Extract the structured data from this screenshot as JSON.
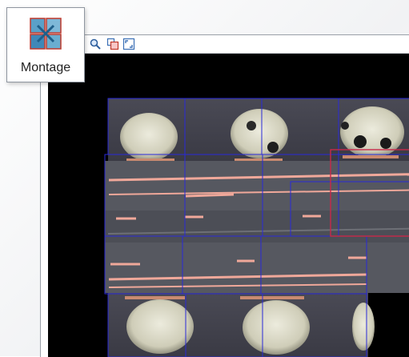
{
  "ribbon": {
    "montage_label": "Montage",
    "montage_icon": "montage-icon"
  },
  "toolbar": {
    "buttons": [
      {
        "name": "zoom-icon"
      },
      {
        "name": "overlay-icon"
      },
      {
        "name": "fit-icon"
      }
    ]
  },
  "colors": {
    "viewport_bg": "#000000",
    "tile_border": "#2a2ad8",
    "selected_tile_border": "#c8284a",
    "pad_color": "#d9d7c4",
    "trace_color": "#f0a89a"
  }
}
